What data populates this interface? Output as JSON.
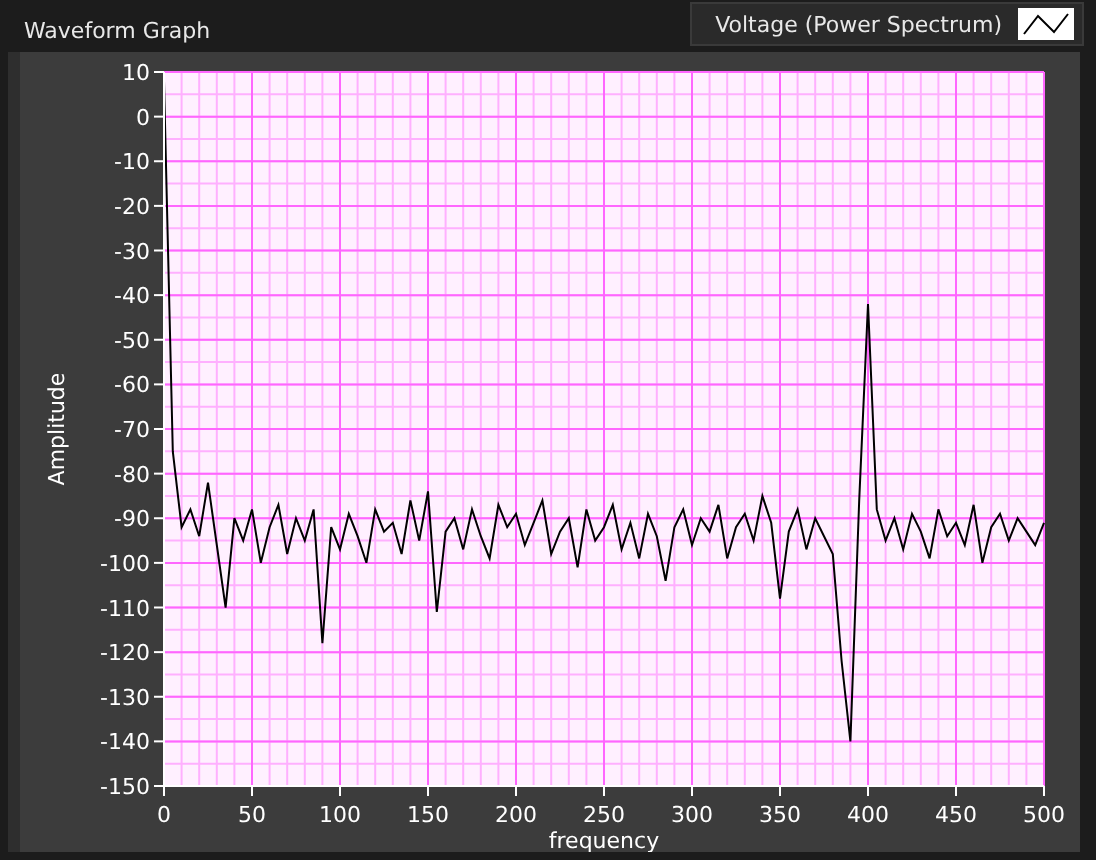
{
  "graph": {
    "label": "Waveform Graph",
    "chart_data": {
      "type": "line",
      "grid": true,
      "xlabel": "frequency",
      "ylabel": "Amplitude",
      "xlim": [
        0,
        500
      ],
      "ylim": [
        -150,
        10
      ],
      "xticks": [
        0,
        50,
        100,
        150,
        200,
        250,
        300,
        350,
        400,
        450,
        500
      ],
      "yticks": [
        10,
        0,
        -10,
        -20,
        -30,
        -40,
        -50,
        -60,
        -70,
        -80,
        -90,
        -100,
        -110,
        -120,
        -130,
        -140,
        -150
      ],
      "x": [
        0,
        5,
        10,
        15,
        20,
        25,
        30,
        35,
        40,
        45,
        50,
        55,
        60,
        65,
        70,
        75,
        80,
        85,
        90,
        95,
        100,
        105,
        110,
        115,
        120,
        125,
        130,
        135,
        140,
        145,
        150,
        155,
        160,
        165,
        170,
        175,
        180,
        185,
        190,
        195,
        200,
        205,
        210,
        215,
        220,
        225,
        230,
        235,
        240,
        245,
        250,
        255,
        260,
        265,
        270,
        275,
        280,
        285,
        290,
        295,
        300,
        305,
        310,
        315,
        320,
        325,
        330,
        335,
        340,
        345,
        350,
        355,
        360,
        365,
        370,
        375,
        380,
        385,
        390,
        395,
        400,
        405,
        410,
        415,
        420,
        425,
        430,
        435,
        440,
        445,
        450,
        455,
        460,
        465,
        470,
        475,
        480,
        485,
        490,
        495,
        500
      ],
      "series": [
        {
          "name": "Voltage (Power Spectrum)",
          "color": "#000000",
          "values": [
            8,
            -75,
            -92,
            -88,
            -94,
            -82,
            -96,
            -110,
            -90,
            -95,
            -88,
            -100,
            -92,
            -87,
            -98,
            -90,
            -95,
            -88,
            -118,
            -92,
            -97,
            -89,
            -94,
            -100,
            -88,
            -93,
            -91,
            -98,
            -86,
            -95,
            -84,
            -111,
            -93,
            -90,
            -97,
            -88,
            -94,
            -99,
            -87,
            -92,
            -89,
            -96,
            -91,
            -86,
            -98,
            -93,
            -90,
            -101,
            -88,
            -95,
            -92,
            -87,
            -97,
            -91,
            -99,
            -89,
            -94,
            -104,
            -92,
            -88,
            -96,
            -90,
            -93,
            -87,
            -99,
            -92,
            -89,
            -95,
            -85,
            -91,
            -108,
            -93,
            -88,
            -97,
            -90,
            -94,
            -98,
            -122,
            -140,
            -86,
            -42,
            -88,
            -95,
            -90,
            -97,
            -89,
            -93,
            -99,
            -88,
            -94,
            -91,
            -96,
            -87,
            -100,
            -92,
            -89,
            -95,
            -90,
            -93,
            -96,
            -91
          ]
        }
      ]
    }
  }
}
